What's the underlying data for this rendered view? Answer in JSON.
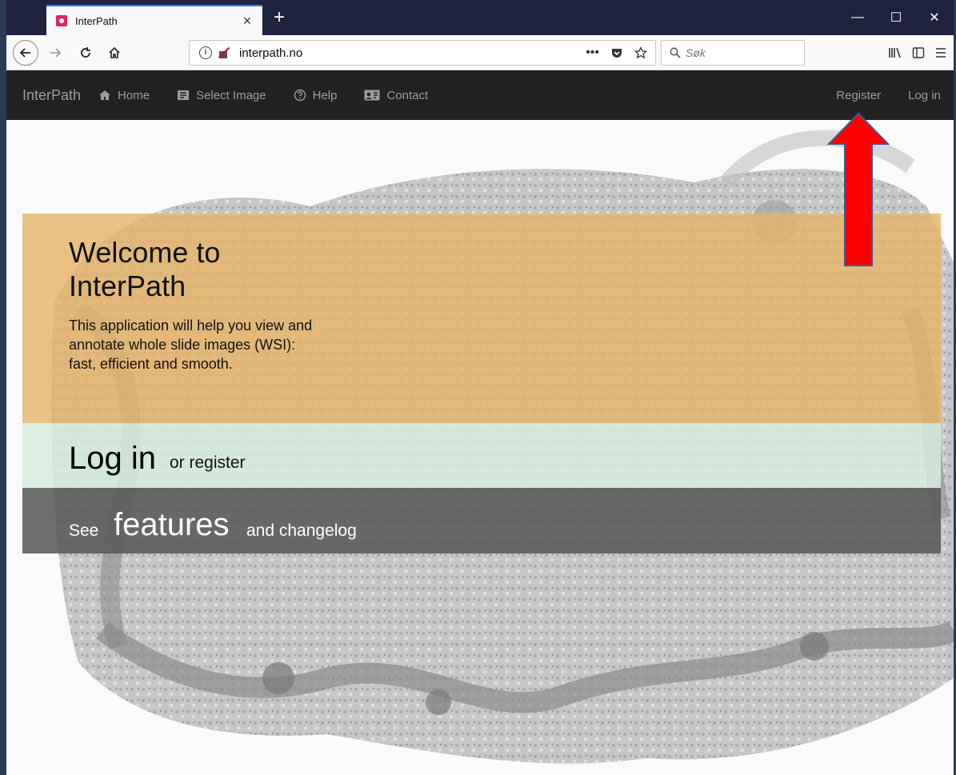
{
  "browser": {
    "tab_title": "InterPath",
    "tab_close": "×",
    "new_tab": "+",
    "url": "interpath.no",
    "url_more": "•••",
    "search_placeholder": "Søk",
    "window": {
      "minimize": "—",
      "maximize": "☐",
      "close": "✕"
    }
  },
  "site": {
    "brand": "InterPath",
    "nav": [
      {
        "label": "Home",
        "icon": "home-icon"
      },
      {
        "label": "Select Image",
        "icon": "image-list-icon"
      },
      {
        "label": "Help",
        "icon": "help-circle-icon"
      },
      {
        "label": "Contact",
        "icon": "contact-card-icon"
      }
    ],
    "nav_right": {
      "register": "Register",
      "login": "Log in"
    }
  },
  "hero": {
    "title": "Welcome to InterPath",
    "description": "This application will help you view and annotate whole slide images (WSI): fast, efficient and smooth."
  },
  "login_band": {
    "big": "Log in",
    "small": "or register"
  },
  "features_band": {
    "prefix": "See",
    "big": "features",
    "small": "and changelog"
  },
  "annotation": {
    "arrow_color": "#ff0000",
    "arrow_target": "Register"
  },
  "colors": {
    "hero": "#e8b469",
    "login_band": "#d6ecde",
    "features_band": "#5a5a5a",
    "site_nav": "#222222"
  }
}
